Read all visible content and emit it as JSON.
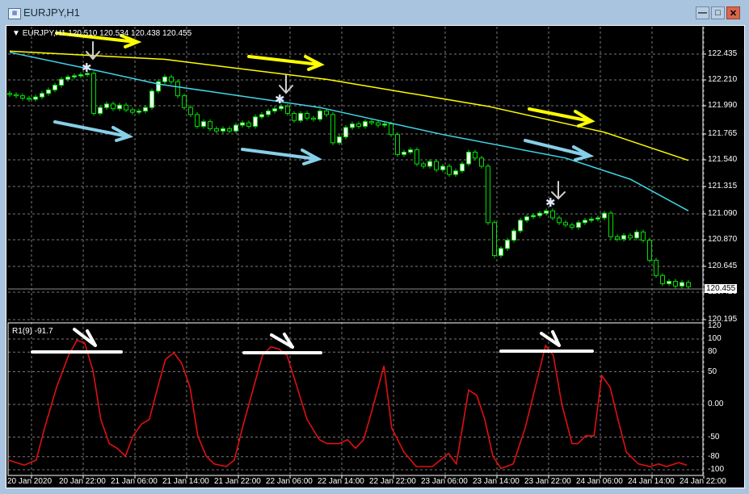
{
  "window": {
    "title": "EURJPY,H1",
    "minimize": "—",
    "maximize": "□",
    "close": "✕"
  },
  "chart_header": {
    "symbol": "EURJPY,H1",
    "ohlc": "120.510 120.534 120.438 120.455"
  },
  "indicator_label": "R1(9) -91.7",
  "price_axis": [
    "122.435",
    "122.210",
    "121.990",
    "121.765",
    "121.540",
    "121.315",
    "121.090",
    "120.870",
    "120.645",
    "120.420",
    "120.195"
  ],
  "current_price": "120.455",
  "indicator_axis": [
    "120",
    "100",
    "80",
    "50",
    "0.00",
    "-50",
    "-80",
    "-100"
  ],
  "time_axis": [
    "20 Jan 2020",
    "20 Jan 22:00",
    "21 Jan 06:00",
    "21 Jan 14:00",
    "21 Jan 22:00",
    "22 Jan 06:00",
    "22 Jan 14:00",
    "22 Jan 22:00",
    "23 Jan 06:00",
    "23 Jan 14:00",
    "23 Jan 22:00",
    "24 Jan 06:00",
    "24 Jan 14:00",
    "24 Jan 22:00"
  ],
  "colors": {
    "bull": "#ffffff",
    "bear": "#000000",
    "wick": "#00e000",
    "ma_slow": "#ffff00",
    "ma_fast": "#40d8e8",
    "indicator": "#e01010"
  },
  "chart_data": {
    "type": "candlestick",
    "ylim": [
      120.195,
      122.435
    ],
    "closes": [
      122.09,
      122.08,
      122.06,
      122.05,
      122.07,
      122.1,
      122.13,
      122.17,
      122.22,
      122.24,
      122.25,
      122.26,
      122.27,
      121.93,
      121.98,
      122.01,
      121.97,
      122.0,
      121.96,
      121.94,
      121.95,
      121.98,
      122.12,
      122.2,
      122.24,
      122.2,
      122.08,
      121.98,
      121.92,
      121.82,
      121.86,
      121.8,
      121.78,
      121.8,
      121.78,
      121.83,
      121.85,
      121.82,
      121.9,
      121.92,
      121.95,
      121.97,
      121.99,
      121.93,
      121.87,
      121.93,
      121.89,
      121.88,
      121.95,
      121.92,
      121.68,
      121.73,
      121.81,
      121.84,
      121.82,
      121.86,
      121.85,
      121.83,
      121.84,
      121.75,
      121.58,
      121.6,
      121.62,
      121.5,
      121.48,
      121.52,
      121.45,
      121.48,
      121.41,
      121.44,
      121.5,
      121.6,
      121.55,
      121.48,
      121.0,
      120.72,
      120.78,
      120.85,
      120.93,
      121.02,
      121.05,
      121.06,
      121.08,
      121.1,
      121.04,
      121.0,
      120.98,
      120.96,
      121.0,
      121.02,
      121.03,
      121.04,
      121.08,
      120.88,
      120.86,
      120.89,
      120.87,
      120.92,
      120.85,
      120.68,
      120.55,
      120.48,
      120.5,
      120.46,
      120.49,
      120.455
    ],
    "ma_slow": [
      [
        0,
        122.46
      ],
      [
        24,
        122.39
      ],
      [
        49,
        122.22
      ],
      [
        74,
        121.99
      ],
      [
        92,
        121.77
      ],
      [
        105,
        121.53
      ]
    ],
    "ma_fast": [
      [
        0,
        122.45
      ],
      [
        13,
        122.3
      ],
      [
        23,
        122.18
      ],
      [
        48,
        121.98
      ],
      [
        67,
        121.75
      ],
      [
        86,
        121.55
      ],
      [
        96,
        121.37
      ],
      [
        105,
        121.1
      ]
    ],
    "indicator": {
      "name": "R1(9)",
      "ylim": [
        -100,
        120
      ],
      "points": [
        [
          -0.25,
          -85
        ],
        [
          2.25,
          -93
        ],
        [
          4.1,
          -85
        ],
        [
          5.4,
          -36
        ],
        [
          7.25,
          26
        ],
        [
          9.1,
          75
        ],
        [
          10.4,
          98
        ],
        [
          11.6,
          94
        ],
        [
          12.9,
          51
        ],
        [
          14.1,
          -23
        ],
        [
          15.4,
          -60
        ],
        [
          16.6,
          -67
        ],
        [
          17.9,
          -79
        ],
        [
          19.1,
          -48
        ],
        [
          20.4,
          -30
        ],
        [
          21.6,
          -23
        ],
        [
          22.9,
          26
        ],
        [
          24.1,
          69
        ],
        [
          25.4,
          79
        ],
        [
          26.6,
          63
        ],
        [
          27.9,
          26
        ],
        [
          29.1,
          -48
        ],
        [
          30.4,
          -79
        ],
        [
          31.6,
          -91
        ],
        [
          33.5,
          -95
        ],
        [
          34.75,
          -85
        ],
        [
          36,
          -36
        ],
        [
          37.9,
          32
        ],
        [
          39.1,
          75
        ],
        [
          40.4,
          88
        ],
        [
          41.6,
          85
        ],
        [
          42.9,
          75
        ],
        [
          44.1,
          38
        ],
        [
          46,
          -23
        ],
        [
          47.9,
          -54
        ],
        [
          49.1,
          -60
        ],
        [
          51,
          -60
        ],
        [
          52.25,
          -54
        ],
        [
          53.5,
          -67
        ],
        [
          54.75,
          -54
        ],
        [
          56,
          -11
        ],
        [
          57.9,
          59
        ],
        [
          59.1,
          -36
        ],
        [
          61,
          -73
        ],
        [
          62.9,
          -95
        ],
        [
          65.4,
          -95
        ],
        [
          67.9,
          -75
        ],
        [
          69.1,
          -91
        ],
        [
          71,
          22
        ],
        [
          72.25,
          14
        ],
        [
          73.5,
          -23
        ],
        [
          74.75,
          -79
        ],
        [
          76,
          -98
        ],
        [
          77.9,
          -91
        ],
        [
          79.75,
          -36
        ],
        [
          81.6,
          38
        ],
        [
          82.9,
          90
        ],
        [
          84.1,
          75
        ],
        [
          85.4,
          1
        ],
        [
          87,
          -60
        ],
        [
          87.9,
          -60
        ],
        [
          89.1,
          -48
        ],
        [
          90.4,
          -48
        ],
        [
          91.6,
          44
        ],
        [
          92.9,
          26
        ],
        [
          94.1,
          -23
        ],
        [
          95.4,
          -73
        ],
        [
          97.25,
          -91
        ],
        [
          99.1,
          -95
        ],
        [
          100.4,
          -91
        ],
        [
          101.6,
          -95
        ],
        [
          103.5,
          -89
        ],
        [
          104.75,
          -93
        ]
      ]
    }
  }
}
